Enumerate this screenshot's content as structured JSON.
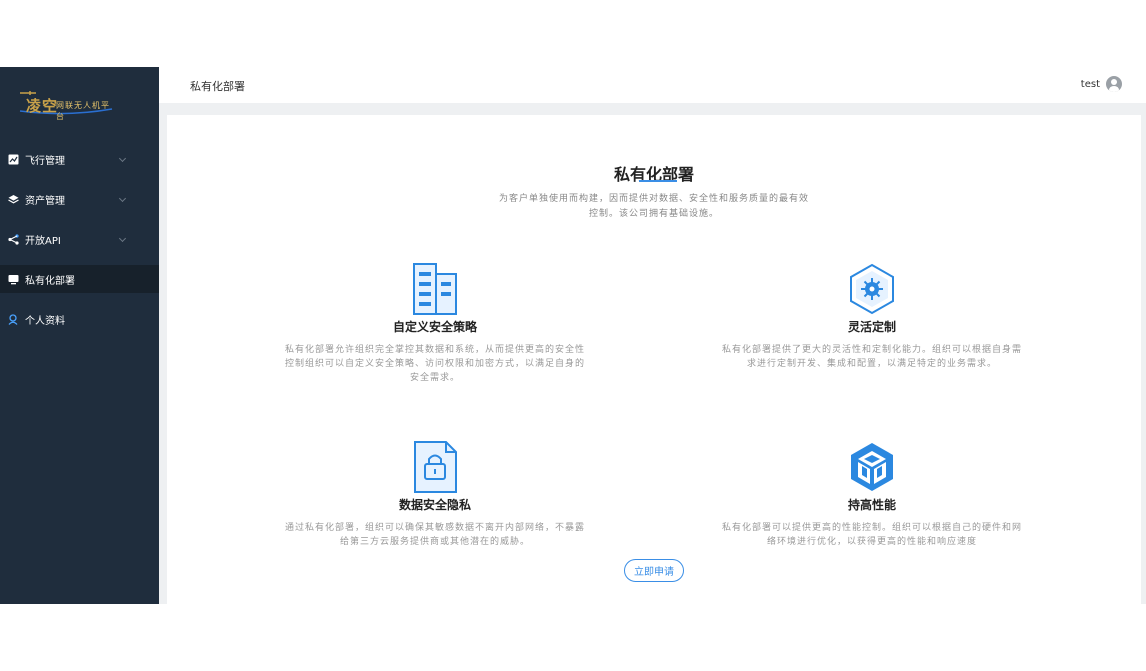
{
  "app": {
    "logo_main": "凌空",
    "logo_sub": "网联无人机平台"
  },
  "sidebar": {
    "items": [
      {
        "label": "飞行管理",
        "icon": "chart-icon",
        "expandable": true
      },
      {
        "label": "资产管理",
        "icon": "layers-icon",
        "expandable": true
      },
      {
        "label": "开放API",
        "icon": "share-icon",
        "expandable": true
      },
      {
        "label": "私有化部署",
        "icon": "monitor-icon",
        "expandable": false,
        "active": true
      },
      {
        "label": "个人资料",
        "icon": "user-icon",
        "expandable": false
      }
    ]
  },
  "header": {
    "breadcrumb": "私有化部署",
    "username": "test"
  },
  "main": {
    "title": "私有化部署",
    "subtitle": "为客户单独使用而构建，因而提供对数据、安全性和服务质量的最有效控制。该公司拥有基础设施。",
    "features": [
      {
        "name": "自定义安全策略",
        "icon": "building-icon",
        "desc": "私有化部署允许组织完全掌控其数据和系统，从而提供更高的安全性控制组织可以自定义安全策略、访问权限和加密方式，以满足自身的安全需求。"
      },
      {
        "name": "灵活定制",
        "icon": "hexagon-gear-icon",
        "desc": "私有化部署提供了更大的灵活性和定制化能力。组织可以根据自身需求进行定制开发、集成和配置，以满足特定的业务需求。"
      },
      {
        "name": "数据安全隐私",
        "icon": "document-lock-icon",
        "desc": "通过私有化部署，组织可以确保其敏感数据不离开内部网络，不暴露给第三方云服务提供商或其他潜在的威胁。"
      },
      {
        "name": "持高性能",
        "icon": "cube-icon",
        "desc": "私有化部署可以提供更高的性能控制。组织可以根据自己的硬件和网络环境进行优化，以获得更高的性能和响应速度"
      }
    ],
    "apply_button": "立即申请"
  },
  "colors": {
    "sidebar_bg": "#1f2d3d",
    "accent": "#3a8ee6",
    "logo_gold": "#c9a24a"
  }
}
